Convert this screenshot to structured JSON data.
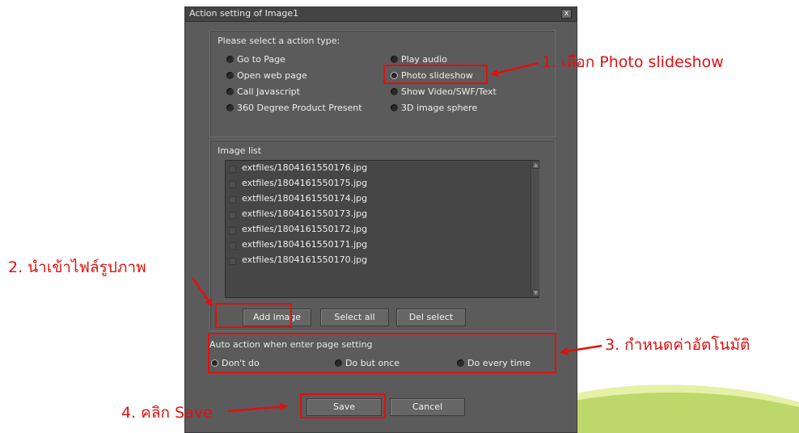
{
  "dialog": {
    "title": "Action setting of Image1",
    "close_label": "x"
  },
  "action_type": {
    "label": "Please select a action type:",
    "options": [
      {
        "label": "Go to Page",
        "checked": false
      },
      {
        "label": "Open web page",
        "checked": false
      },
      {
        "label": "Call Javascript",
        "checked": false
      },
      {
        "label": "360 Degree Product Present",
        "checked": false
      },
      {
        "label": "Play audio",
        "checked": false
      },
      {
        "label": "Photo slideshow",
        "checked": true
      },
      {
        "label": "Show Video/SWF/Text",
        "checked": false
      },
      {
        "label": "3D image sphere",
        "checked": false
      }
    ]
  },
  "image_list": {
    "label": "Image list",
    "items": [
      "extfiles/1804161550176.jpg",
      "extfiles/1804161550175.jpg",
      "extfiles/1804161550174.jpg",
      "extfiles/1804161550173.jpg",
      "extfiles/1804161550172.jpg",
      "extfiles/1804161550171.jpg",
      "extfiles/1804161550170.jpg"
    ],
    "add_label": "Add image",
    "select_all_label": "Select all",
    "del_select_label": "Del select"
  },
  "auto_action": {
    "label": "Auto action when enter page setting",
    "options": [
      {
        "label": "Don't do",
        "checked": true
      },
      {
        "label": "Do but once",
        "checked": false
      },
      {
        "label": "Do every time",
        "checked": false
      }
    ]
  },
  "footer": {
    "save_label": "Save",
    "cancel_label": "Cancel"
  },
  "annotations": {
    "step1": "1. เลือก Photo slideshow",
    "step2": "2. นำเข้าไฟล์รูปภาพ",
    "step3": "3. กำหนดค่าอัตโนมัติ",
    "step4": "4. คลิก Save"
  },
  "colors": {
    "annotation_red": "#e01010",
    "dialog_bg": "#5b5b5b"
  }
}
